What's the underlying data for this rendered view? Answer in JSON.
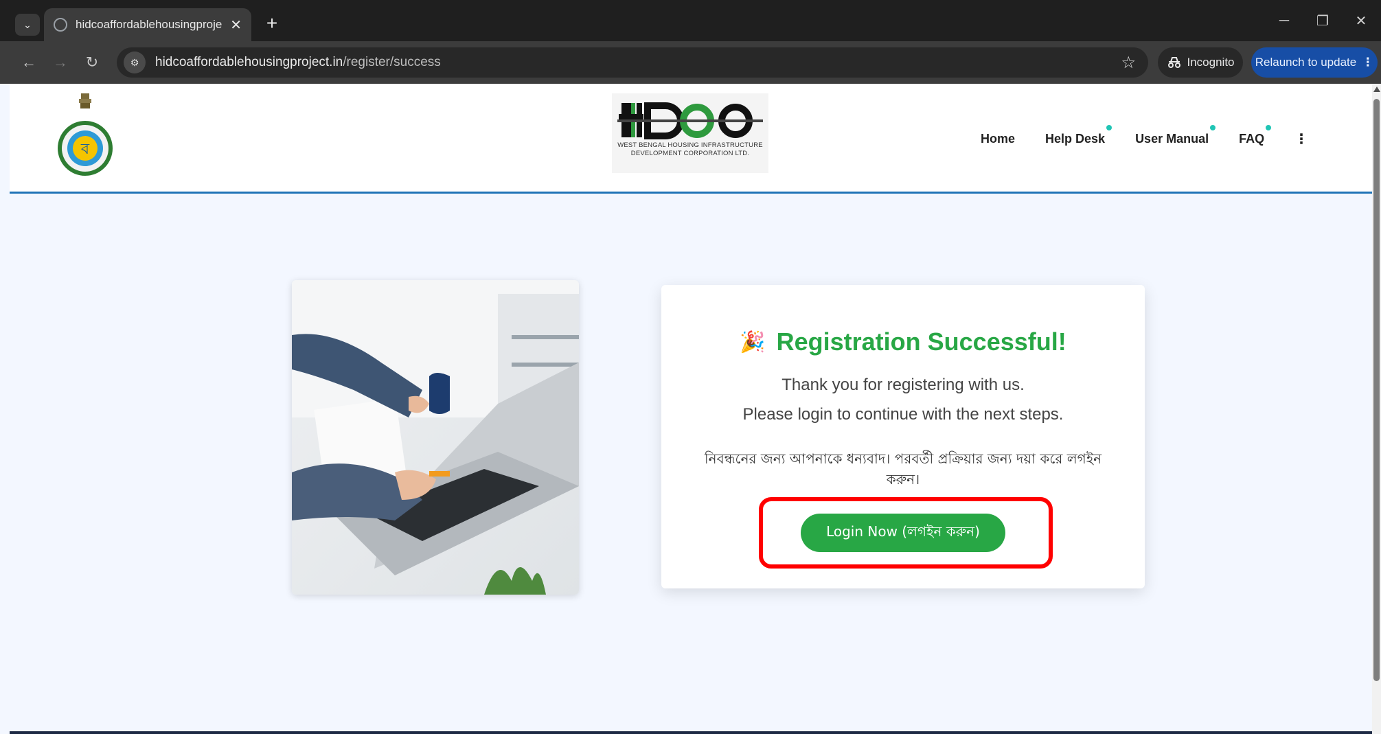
{
  "browser": {
    "tab_title": "hidcoaffordablehousingproject.",
    "new_tab": "+",
    "url_domain": "hidcoaffordablehousingproject.in",
    "url_path": "/register/success",
    "incognito_label": "Incognito",
    "relaunch_label": "Relaunch to update",
    "icons": {
      "tab_search": "chevron-down-icon",
      "back": "back-arrow-icon",
      "forward": "forward-arrow-icon",
      "reload": "reload-icon",
      "bookmark": "star-icon",
      "menu": "kebab-icon"
    }
  },
  "header": {
    "logo_caption": "WEST BENGAL HOUSING INFRASTRUCTURE DEVELOPMENT CORPORATION LTD.",
    "nav": [
      {
        "label": "Home"
      },
      {
        "label": "Help Desk"
      },
      {
        "label": "User Manual"
      },
      {
        "label": "FAQ"
      }
    ],
    "more_glyph": "⋮"
  },
  "card": {
    "title": "Registration Successful!",
    "line1": "Thank you for registering with us.",
    "line2": "Please login to continue with the next steps.",
    "bengali": "নিবন্ধনের জন্য আপনাকে ধন্যবাদ। পরবর্তী প্রক্রিয়ার জন্য দয়া করে লগইন করুন।",
    "button_label": "Login Now (লগইন করুন)"
  },
  "colors": {
    "accent_green": "#28a745",
    "header_rule": "#1f73b7",
    "highlight": "#ff0000",
    "page_bg": "#f3f7ff"
  }
}
